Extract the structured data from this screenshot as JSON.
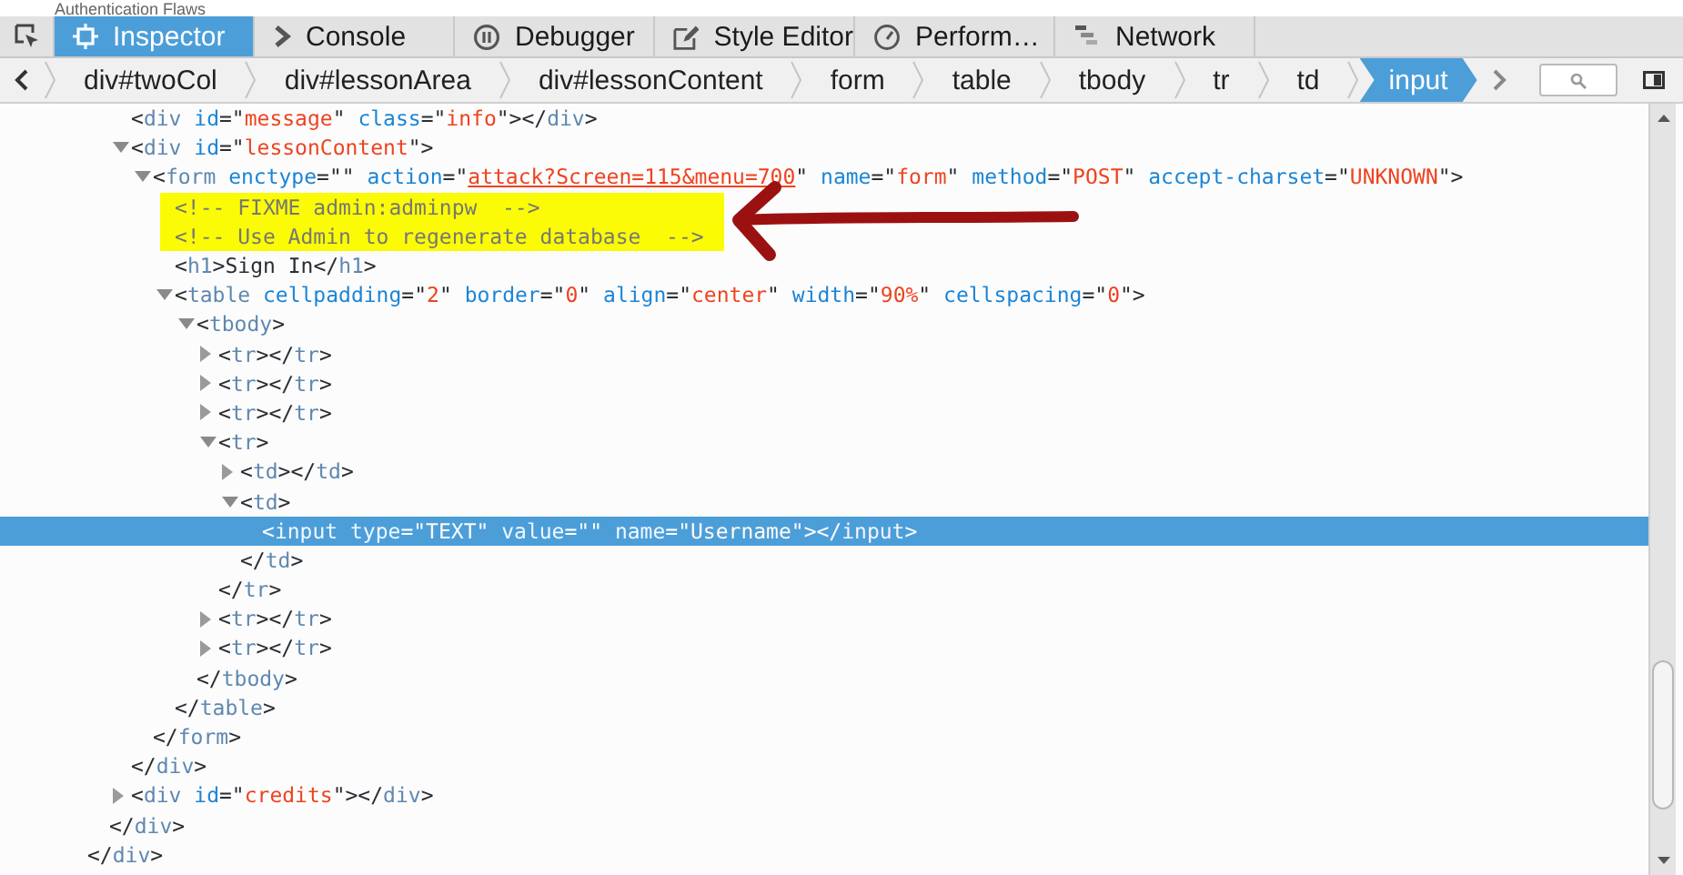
{
  "page_behind": {
    "heading": "Authentication Flaws"
  },
  "toolbox": {
    "tabs": [
      {
        "label": "Inspector",
        "selected": true
      },
      {
        "label": "Console",
        "selected": false
      },
      {
        "label": "Debugger",
        "selected": false
      },
      {
        "label": "Style Editor",
        "selected": false
      },
      {
        "label": "Perform…",
        "selected": false
      },
      {
        "label": "Network",
        "selected": false
      }
    ]
  },
  "breadcrumbs": [
    {
      "label": "div#twoCol",
      "selected": false
    },
    {
      "label": "div#lessonArea",
      "selected": false
    },
    {
      "label": "div#lessonContent",
      "selected": false
    },
    {
      "label": "form",
      "selected": false
    },
    {
      "label": "table",
      "selected": false
    },
    {
      "label": "tbody",
      "selected": false
    },
    {
      "label": "tr",
      "selected": false
    },
    {
      "label": "td",
      "selected": false
    },
    {
      "label": "input",
      "selected": true
    }
  ],
  "markup_tree": [
    {
      "close": [
        {
          "kind": "punct",
          "text": "</"
        },
        {
          "kind": "tag",
          "text": "div"
        },
        {
          "kind": "punct",
          "text": ">"
        }
      ],
      "children": [
        {
          "close": [
            {
              "kind": "punct",
              "text": "</"
            },
            {
              "kind": "tag",
              "text": "div"
            },
            {
              "kind": "punct",
              "text": ">"
            }
          ],
          "children": [
            {
              "selected": false,
              "line": [
                {
                  "kind": "punct",
                  "text": "<"
                },
                {
                  "kind": "tag",
                  "text": "div"
                },
                {
                  "kind": "attr",
                  "text": " id"
                },
                {
                  "kind": "punct",
                  "text": "=\""
                },
                {
                  "kind": "value",
                  "text": "message"
                },
                {
                  "kind": "punct",
                  "text": "\" "
                },
                {
                  "kind": "attr",
                  "text": "class"
                },
                {
                  "kind": "punct",
                  "text": "=\""
                },
                {
                  "kind": "value",
                  "text": "info"
                },
                {
                  "kind": "punct",
                  "text": "\"></"
                },
                {
                  "kind": "tag",
                  "text": "div"
                },
                {
                  "kind": "punct",
                  "text": ">"
                }
              ]
            },
            {
              "selected": false,
              "expanded": true,
              "line": [
                {
                  "kind": "punct",
                  "text": "<"
                },
                {
                  "kind": "tag",
                  "text": "div"
                },
                {
                  "kind": "attr",
                  "text": " id"
                },
                {
                  "kind": "punct",
                  "text": "=\""
                },
                {
                  "kind": "value",
                  "text": "lessonContent"
                },
                {
                  "kind": "punct",
                  "text": "\">"
                }
              ],
              "close": [
                {
                  "kind": "punct",
                  "text": "</"
                },
                {
                  "kind": "tag",
                  "text": "div"
                },
                {
                  "kind": "punct",
                  "text": ">"
                }
              ],
              "children": [
                {
                  "selected": false,
                  "expanded": true,
                  "line": [
                    {
                      "kind": "punct",
                      "text": "<"
                    },
                    {
                      "kind": "tag",
                      "text": "form"
                    },
                    {
                      "kind": "attr",
                      "text": " enctype"
                    },
                    {
                      "kind": "punct",
                      "text": "=\"\" "
                    },
                    {
                      "kind": "attr",
                      "text": "action"
                    },
                    {
                      "kind": "punct",
                      "text": "=\""
                    },
                    {
                      "kind": "link",
                      "text": "attack?Screen=115&menu=700"
                    },
                    {
                      "kind": "punct",
                      "text": "\" "
                    },
                    {
                      "kind": "attr",
                      "text": "name"
                    },
                    {
                      "kind": "punct",
                      "text": "=\""
                    },
                    {
                      "kind": "value",
                      "text": "form"
                    },
                    {
                      "kind": "punct",
                      "text": "\" "
                    },
                    {
                      "kind": "attr",
                      "text": "method"
                    },
                    {
                      "kind": "punct",
                      "text": "=\""
                    },
                    {
                      "kind": "value",
                      "text": "POST"
                    },
                    {
                      "kind": "punct",
                      "text": "\" "
                    },
                    {
                      "kind": "attr",
                      "text": "accept-charset"
                    },
                    {
                      "kind": "punct",
                      "text": "=\""
                    },
                    {
                      "kind": "value",
                      "text": "UNKNOWN"
                    },
                    {
                      "kind": "punct",
                      "text": "\">"
                    }
                  ],
                  "close": [
                    {
                      "kind": "punct",
                      "text": "</"
                    },
                    {
                      "kind": "tag",
                      "text": "form"
                    },
                    {
                      "kind": "punct",
                      "text": ">"
                    }
                  ],
                  "children": [
                    {
                      "selected": false,
                      "highlighted": true,
                      "line": [
                        {
                          "kind": "comment",
                          "text": "<!-- FIXME admin:adminpw  -->"
                        }
                      ]
                    },
                    {
                      "selected": false,
                      "highlighted": true,
                      "line": [
                        {
                          "kind": "comment",
                          "text": "<!-- Use Admin to regenerate database  -->"
                        }
                      ]
                    },
                    {
                      "selected": false,
                      "line": [
                        {
                          "kind": "punct",
                          "text": "<"
                        },
                        {
                          "kind": "tag",
                          "text": "h1"
                        },
                        {
                          "kind": "punct",
                          "text": ">"
                        },
                        {
                          "kind": "text",
                          "text": "Sign In"
                        },
                        {
                          "kind": "punct",
                          "text": "</"
                        },
                        {
                          "kind": "tag",
                          "text": "h1"
                        },
                        {
                          "kind": "punct",
                          "text": ">"
                        }
                      ]
                    },
                    {
                      "selected": false,
                      "expanded": true,
                      "line": [
                        {
                          "kind": "punct",
                          "text": "<"
                        },
                        {
                          "kind": "tag",
                          "text": "table"
                        },
                        {
                          "kind": "attr",
                          "text": " cellpadding"
                        },
                        {
                          "kind": "punct",
                          "text": "=\""
                        },
                        {
                          "kind": "value",
                          "text": "2"
                        },
                        {
                          "kind": "punct",
                          "text": "\" "
                        },
                        {
                          "kind": "attr",
                          "text": "border"
                        },
                        {
                          "kind": "punct",
                          "text": "=\""
                        },
                        {
                          "kind": "value",
                          "text": "0"
                        },
                        {
                          "kind": "punct",
                          "text": "\" "
                        },
                        {
                          "kind": "attr",
                          "text": "align"
                        },
                        {
                          "kind": "punct",
                          "text": "=\""
                        },
                        {
                          "kind": "value",
                          "text": "center"
                        },
                        {
                          "kind": "punct",
                          "text": "\" "
                        },
                        {
                          "kind": "attr",
                          "text": "width"
                        },
                        {
                          "kind": "punct",
                          "text": "=\""
                        },
                        {
                          "kind": "value",
                          "text": "90%"
                        },
                        {
                          "kind": "punct",
                          "text": "\" "
                        },
                        {
                          "kind": "attr",
                          "text": "cellspacing"
                        },
                        {
                          "kind": "punct",
                          "text": "=\""
                        },
                        {
                          "kind": "value",
                          "text": "0"
                        },
                        {
                          "kind": "punct",
                          "text": "\">"
                        }
                      ],
                      "close": [
                        {
                          "kind": "punct",
                          "text": "</"
                        },
                        {
                          "kind": "tag",
                          "text": "table"
                        },
                        {
                          "kind": "punct",
                          "text": ">"
                        }
                      ],
                      "children": [
                        {
                          "selected": false,
                          "expanded": true,
                          "line": [
                            {
                              "kind": "punct",
                              "text": "<"
                            },
                            {
                              "kind": "tag",
                              "text": "tbody"
                            },
                            {
                              "kind": "punct",
                              "text": ">"
                            }
                          ],
                          "close": [
                            {
                              "kind": "punct",
                              "text": "</"
                            },
                            {
                              "kind": "tag",
                              "text": "tbody"
                            },
                            {
                              "kind": "punct",
                              "text": ">"
                            }
                          ],
                          "children": [
                            {
                              "selected": false,
                              "expanded": false,
                              "line": [
                                {
                                  "kind": "punct",
                                  "text": "<"
                                },
                                {
                                  "kind": "tag",
                                  "text": "tr"
                                },
                                {
                                  "kind": "punct",
                                  "text": "></"
                                },
                                {
                                  "kind": "tag",
                                  "text": "tr"
                                },
                                {
                                  "kind": "punct",
                                  "text": ">"
                                }
                              ]
                            },
                            {
                              "selected": false,
                              "expanded": false,
                              "line": [
                                {
                                  "kind": "punct",
                                  "text": "<"
                                },
                                {
                                  "kind": "tag",
                                  "text": "tr"
                                },
                                {
                                  "kind": "punct",
                                  "text": "></"
                                },
                                {
                                  "kind": "tag",
                                  "text": "tr"
                                },
                                {
                                  "kind": "punct",
                                  "text": ">"
                                }
                              ]
                            },
                            {
                              "selected": false,
                              "expanded": false,
                              "line": [
                                {
                                  "kind": "punct",
                                  "text": "<"
                                },
                                {
                                  "kind": "tag",
                                  "text": "tr"
                                },
                                {
                                  "kind": "punct",
                                  "text": "></"
                                },
                                {
                                  "kind": "tag",
                                  "text": "tr"
                                },
                                {
                                  "kind": "punct",
                                  "text": ">"
                                }
                              ]
                            },
                            {
                              "selected": false,
                              "expanded": true,
                              "line": [
                                {
                                  "kind": "punct",
                                  "text": "<"
                                },
                                {
                                  "kind": "tag",
                                  "text": "tr"
                                },
                                {
                                  "kind": "punct",
                                  "text": ">"
                                }
                              ],
                              "close": [
                                {
                                  "kind": "punct",
                                  "text": "</"
                                },
                                {
                                  "kind": "tag",
                                  "text": "tr"
                                },
                                {
                                  "kind": "punct",
                                  "text": ">"
                                }
                              ],
                              "children": [
                                {
                                  "selected": false,
                                  "expanded": false,
                                  "line": [
                                    {
                                      "kind": "punct",
                                      "text": "<"
                                    },
                                    {
                                      "kind": "tag",
                                      "text": "td"
                                    },
                                    {
                                      "kind": "punct",
                                      "text": "></"
                                    },
                                    {
                                      "kind": "tag",
                                      "text": "td"
                                    },
                                    {
                                      "kind": "punct",
                                      "text": ">"
                                    }
                                  ]
                                },
                                {
                                  "selected": false,
                                  "expanded": true,
                                  "line": [
                                    {
                                      "kind": "punct",
                                      "text": "<"
                                    },
                                    {
                                      "kind": "tag",
                                      "text": "td"
                                    },
                                    {
                                      "kind": "punct",
                                      "text": ">"
                                    }
                                  ],
                                  "close": [
                                    {
                                      "kind": "punct",
                                      "text": "</"
                                    },
                                    {
                                      "kind": "tag",
                                      "text": "td"
                                    },
                                    {
                                      "kind": "punct",
                                      "text": ">"
                                    }
                                  ],
                                  "children": [
                                    {
                                      "selected": true,
                                      "line": [
                                        {
                                          "kind": "punct",
                                          "text": "<"
                                        },
                                        {
                                          "kind": "tag",
                                          "text": "input"
                                        },
                                        {
                                          "kind": "attr",
                                          "text": " type"
                                        },
                                        {
                                          "kind": "punct",
                                          "text": "=\""
                                        },
                                        {
                                          "kind": "value",
                                          "text": "TEXT"
                                        },
                                        {
                                          "kind": "punct",
                                          "text": "\" "
                                        },
                                        {
                                          "kind": "attr",
                                          "text": "value"
                                        },
                                        {
                                          "kind": "punct",
                                          "text": "=\"\" "
                                        },
                                        {
                                          "kind": "attr",
                                          "text": "name"
                                        },
                                        {
                                          "kind": "punct",
                                          "text": "=\""
                                        },
                                        {
                                          "kind": "value",
                                          "text": "Username"
                                        },
                                        {
                                          "kind": "punct",
                                          "text": "\"></"
                                        },
                                        {
                                          "kind": "tag",
                                          "text": "input"
                                        },
                                        {
                                          "kind": "punct",
                                          "text": ">"
                                        }
                                      ]
                                    }
                                  ]
                                }
                              ]
                            },
                            {
                              "selected": false,
                              "expanded": false,
                              "line": [
                                {
                                  "kind": "punct",
                                  "text": "<"
                                },
                                {
                                  "kind": "tag",
                                  "text": "tr"
                                },
                                {
                                  "kind": "punct",
                                  "text": "></"
                                },
                                {
                                  "kind": "tag",
                                  "text": "tr"
                                },
                                {
                                  "kind": "punct",
                                  "text": ">"
                                }
                              ]
                            },
                            {
                              "selected": false,
                              "expanded": false,
                              "line": [
                                {
                                  "kind": "punct",
                                  "text": "<"
                                },
                                {
                                  "kind": "tag",
                                  "text": "tr"
                                },
                                {
                                  "kind": "punct",
                                  "text": "></"
                                },
                                {
                                  "kind": "tag",
                                  "text": "tr"
                                },
                                {
                                  "kind": "punct",
                                  "text": ">"
                                }
                              ]
                            }
                          ]
                        }
                      ]
                    }
                  ]
                }
              ]
            },
            {
              "selected": false,
              "expanded": false,
              "line": [
                {
                  "kind": "punct",
                  "text": "<"
                },
                {
                  "kind": "tag",
                  "text": "div"
                },
                {
                  "kind": "attr",
                  "text": " id"
                },
                {
                  "kind": "punct",
                  "text": "=\""
                },
                {
                  "kind": "value",
                  "text": "credits"
                },
                {
                  "kind": "punct",
                  "text": "\"></"
                },
                {
                  "kind": "tag",
                  "text": "div"
                },
                {
                  "kind": "punct",
                  "text": ">"
                }
              ]
            }
          ]
        }
      ]
    }
  ]
}
